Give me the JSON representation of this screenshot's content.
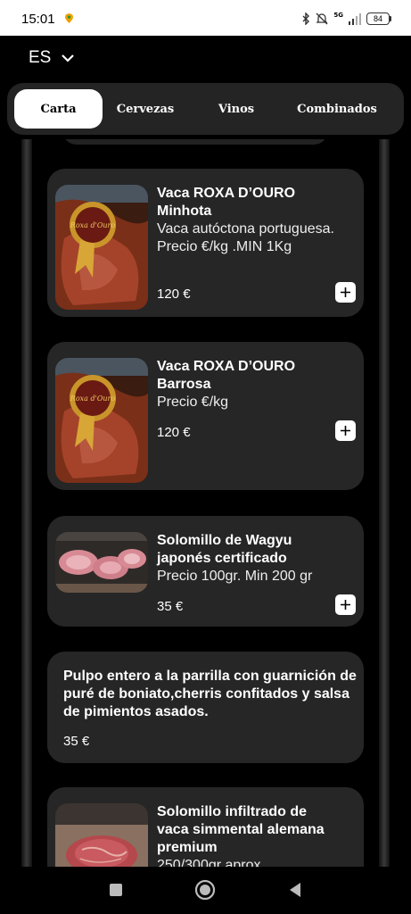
{
  "status_bar": {
    "time": "15:01",
    "network": "5G",
    "battery": "84"
  },
  "language": {
    "label": "ES"
  },
  "tabs": [
    {
      "label": "Carta",
      "active": true
    },
    {
      "label": "Cervezas",
      "active": false
    },
    {
      "label": "Vinos",
      "active": false
    },
    {
      "label": "Combinados",
      "active": false
    }
  ],
  "items": [
    {
      "title": "Vaca ROXA D’OURO Minhota",
      "description": "Vaca autóctona portuguesa. Precio €/kg .MIN 1Kg",
      "price": "120 €",
      "image_badge": "Roxa d'Ouro"
    },
    {
      "title": "Vaca ROXA D’OURO Barrosa",
      "description": "Precio €/kg",
      "price": "120 €",
      "image_badge": "Roxa d'Ouro"
    },
    {
      "title": "Solomillo de Wagyu japonés certificado",
      "description": "Precio 100gr. Min 200 gr",
      "price": "35 €"
    },
    {
      "title": "Pulpo entero a la parrilla con guarnición de puré de boniato,cherris confitados y salsa de pimientos asados.",
      "price": "35 €"
    },
    {
      "title": "Solomillo infiltrado de vaca simmental alemana premium",
      "description": "250/300gr aprox."
    }
  ],
  "colors": {
    "background": "#000000",
    "card": "#262626",
    "tab_bar": "#242424",
    "active_tab": "#ffffff"
  }
}
